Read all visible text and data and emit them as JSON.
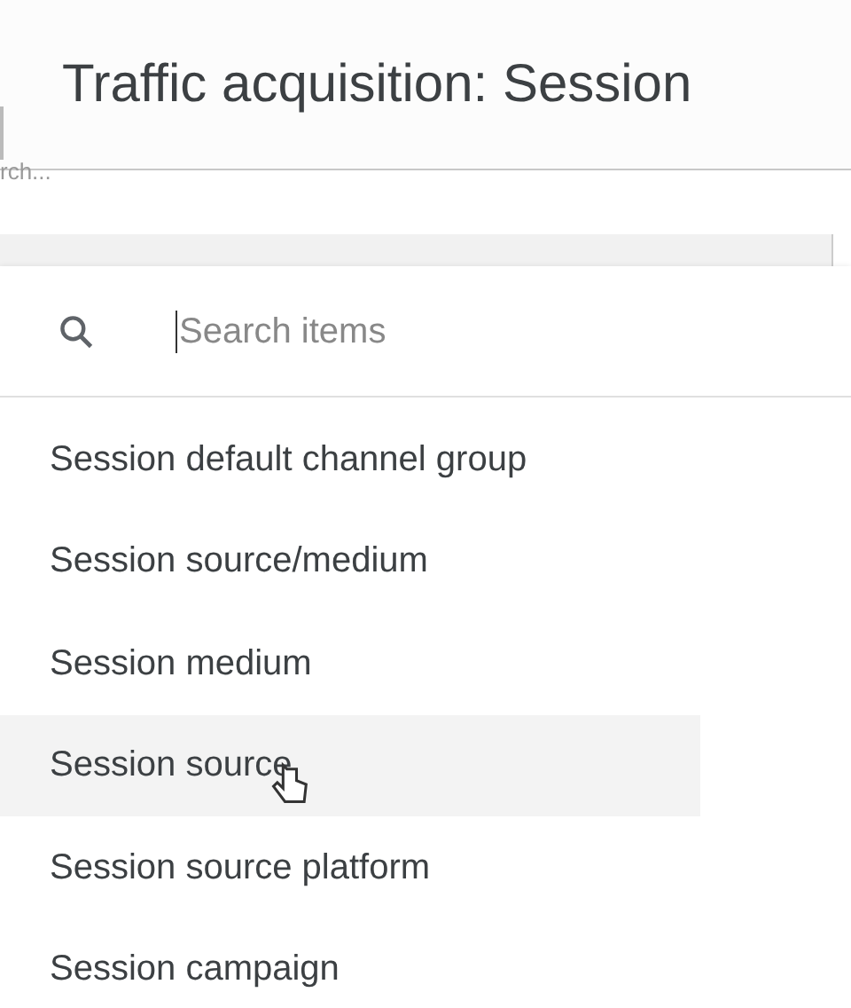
{
  "header": {
    "title": "Traffic acquisition: Session"
  },
  "behind_text": "rch...",
  "search": {
    "placeholder": "Search items"
  },
  "items": [
    {
      "label": "Session default channel group",
      "highlighted": false
    },
    {
      "label": "Session source/medium",
      "highlighted": false
    },
    {
      "label": "Session medium",
      "highlighted": false
    },
    {
      "label": "Session source",
      "highlighted": true
    },
    {
      "label": "Session source platform",
      "highlighted": false
    },
    {
      "label": "Session campaign",
      "highlighted": false
    }
  ]
}
